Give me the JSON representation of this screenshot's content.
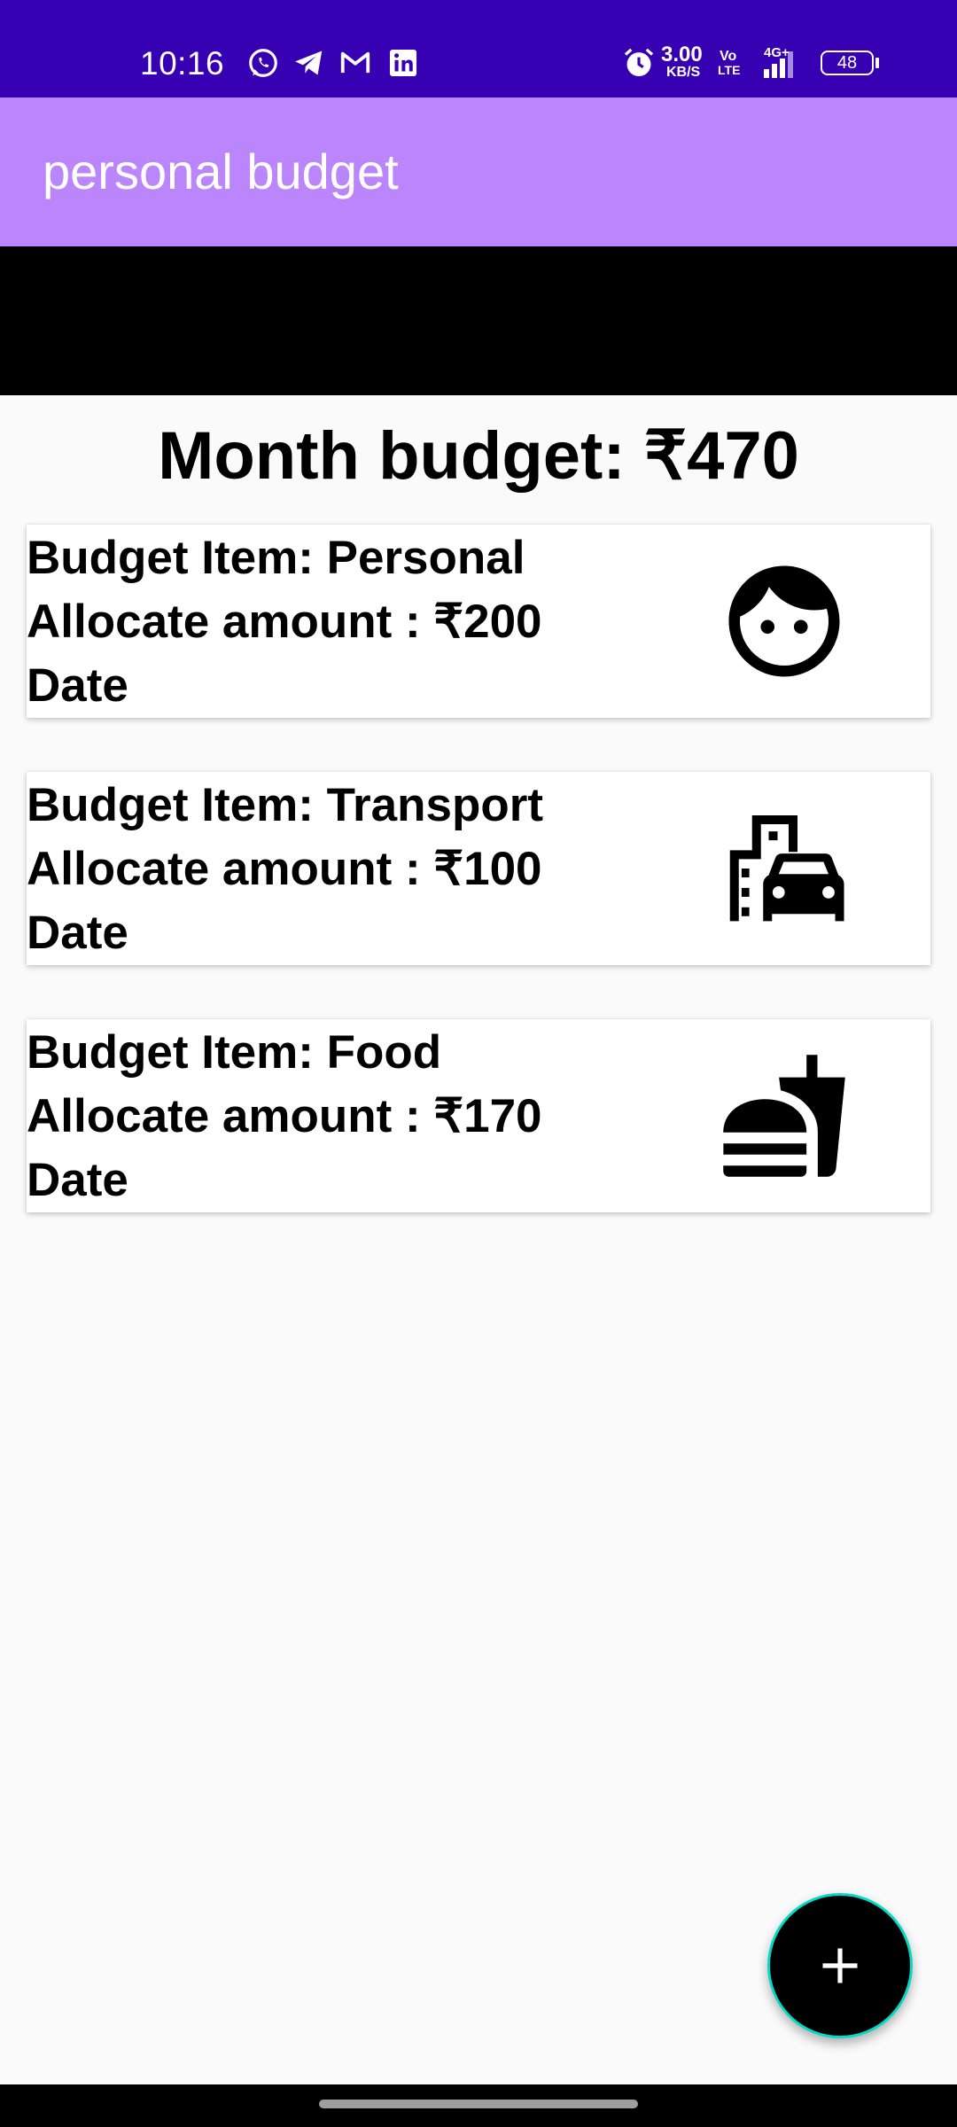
{
  "status_bar": {
    "time": "10:16",
    "net_speed_value": "3.00",
    "net_speed_unit": "KB/S",
    "volte_top": "Vo",
    "volte_bottom": "LTE",
    "network": "4G+",
    "battery": "48",
    "notification_icons": [
      "whatsapp-icon",
      "telegram-icon",
      "gmail-icon",
      "linkedin-icon"
    ],
    "background": "#3700b3"
  },
  "app_bar": {
    "title": "personal budget",
    "background": "#bb86fc"
  },
  "summary": {
    "month_budget": "Month budget: ₹470"
  },
  "budget_items": [
    {
      "title": "Budget Item: Personal",
      "amount": "Allocate amount : ₹200",
      "date": "Date",
      "icon": "face-icon"
    },
    {
      "title": "Budget Item: Transport",
      "amount": "Allocate amount : ₹100",
      "date": "Date",
      "icon": "transportation-icon"
    },
    {
      "title": "Budget Item: Food",
      "amount": "Allocate amount : ₹170",
      "date": "Date",
      "icon": "fastfood-icon"
    }
  ],
  "fab": {
    "icon": "plus-icon",
    "background": "#000000",
    "border": "#03dac5"
  }
}
